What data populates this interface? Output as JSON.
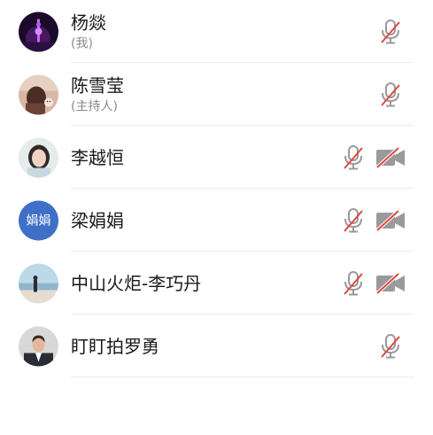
{
  "participants": [
    {
      "name": "杨燚",
      "role": "(我)",
      "avatar": "photo-purple-tower",
      "mic": "muted",
      "camera": null
    },
    {
      "name": "陈雪莹",
      "role": "(主持人)",
      "avatar": "photo-girl-back",
      "mic": "muted",
      "camera": null
    },
    {
      "name": "李越恒",
      "role": "",
      "avatar": "photo-woman",
      "mic": "muted",
      "camera": "off"
    },
    {
      "name": "梁娟娟",
      "role": "",
      "avatar": "text",
      "avatar_text": "娟娟",
      "mic": "muted",
      "camera": "off"
    },
    {
      "name": "中山火炬-李巧丹",
      "role": "",
      "avatar": "photo-beach",
      "mic": "muted",
      "camera": "off"
    },
    {
      "name": "盯盯拍罗勇",
      "role": "",
      "avatar": "photo-man-suit",
      "mic": "muted",
      "camera": null
    }
  ],
  "colors": {
    "accent": "#3f70c7",
    "muted_slash": "#e0483e",
    "icon_gray": "#9a9a9a",
    "divider": "#ececec"
  },
  "icons": {
    "mic_muted": "mic-muted-icon",
    "camera_off": "camera-off-icon"
  }
}
